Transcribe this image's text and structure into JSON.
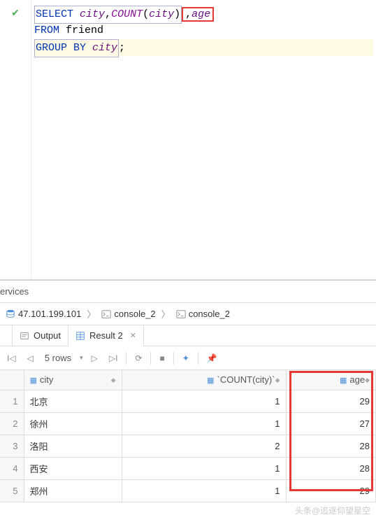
{
  "sql": {
    "line1_select": "SELECT",
    "line1_col1": "city",
    "line1_comma1": ",",
    "line1_func": "COUNT",
    "line1_paren_open": "(",
    "line1_func_arg": "city",
    "line1_paren_close": ")",
    "line1_comma2": ",",
    "line1_col2": "age",
    "line2_from": "FROM",
    "line2_table": "friend",
    "line3_groupby": "GROUP BY",
    "line3_col": "city",
    "line3_semi": ";"
  },
  "services_label": "ervices",
  "breadcrumb": {
    "server": "47.101.199.101",
    "console1": "console_2",
    "console2": "console_2"
  },
  "tabs": {
    "output": "Output",
    "result": "Result 2"
  },
  "toolbar": {
    "rows_label": "5 rows"
  },
  "table": {
    "columns": {
      "city": "city",
      "count": "`COUNT(city)`",
      "age": "age"
    },
    "rows": [
      {
        "n": "1",
        "city": "北京",
        "count": "1",
        "age": "29"
      },
      {
        "n": "2",
        "city": "徐州",
        "count": "1",
        "age": "27"
      },
      {
        "n": "3",
        "city": "洛阳",
        "count": "2",
        "age": "28"
      },
      {
        "n": "4",
        "city": "西安",
        "count": "1",
        "age": "28"
      },
      {
        "n": "5",
        "city": "郑州",
        "count": "1",
        "age": "29"
      }
    ]
  },
  "watermark": "头条@追逐仰望星空"
}
